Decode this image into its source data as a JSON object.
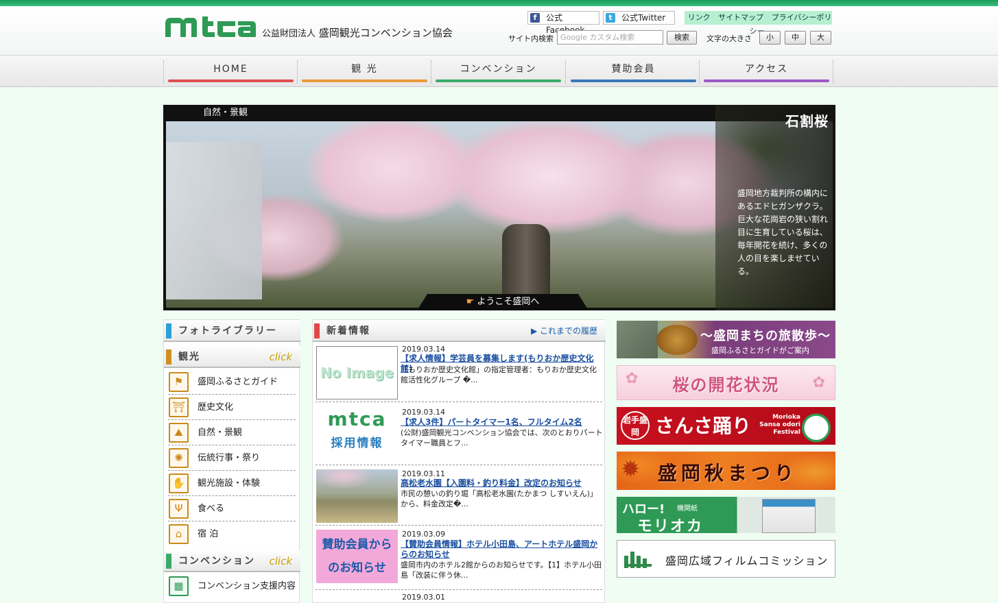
{
  "header": {
    "logo_text": "mtca",
    "org_prefix": "公益財団法人",
    "org_name": "盛岡観光コンベンション協会",
    "facebook_label": "公式Facebook",
    "twitter_label": "公式Twitter",
    "utility_links": [
      "リンク",
      "サイトマップ",
      "プライバシーポリシー"
    ],
    "search_label": "サイト内検索",
    "search_placeholder": "Google カスタム検索",
    "search_button": "検索",
    "text_size_label": "文字の大きさ",
    "text_sizes": [
      "小",
      "中",
      "大"
    ]
  },
  "nav": [
    {
      "label": "HOME",
      "color": "#e05050"
    },
    {
      "label": "観 光",
      "color": "#e89a3a"
    },
    {
      "label": "コンベンション",
      "color": "#3aaa6a"
    },
    {
      "label": "賛助会員",
      "color": "#3a78b8"
    },
    {
      "label": "アクセス",
      "color": "#9a5ac8"
    }
  ],
  "hero": {
    "category": "自然・景観",
    "title": "石割桜",
    "description": "盛岡地方裁判所の構内にあるエドヒガンザクラ。巨大な花崗岩の狭い割れ目に生育している桜は、毎年開花を続け、多くの人の目を楽しませている。",
    "welcome": "ようこそ盛岡へ"
  },
  "sidebar": {
    "photo_library": "フォトライブラリー",
    "tourism": {
      "title": "観光",
      "click": "click",
      "items": [
        {
          "label": "盛岡ふるさとガイド",
          "icon": "guide-icon"
        },
        {
          "label": "歴史文化",
          "icon": "castle-icon"
        },
        {
          "label": "自然・景観",
          "icon": "mountain-icon"
        },
        {
          "label": "伝統行事・祭り",
          "icon": "fan-icon"
        },
        {
          "label": "観光施設・体験",
          "icon": "person-icon"
        },
        {
          "label": "食べる",
          "icon": "chopsticks-icon"
        },
        {
          "label": "宿 泊",
          "icon": "hotel-icon"
        }
      ]
    },
    "convention": {
      "title": "コンベンション",
      "click": "click",
      "items": [
        {
          "label": "コンベンション支援内容",
          "icon": "convention-icon"
        }
      ]
    },
    "colors": {
      "photo": "#2aa0d8",
      "tourism": "#d09020",
      "convention": "#3aaa6a"
    }
  },
  "news": {
    "title": "新着情報",
    "more": "▶ これまでの履歴",
    "items": [
      {
        "date": "2019.03.14",
        "title": "【求人情報】学芸員を募集します(もりおか歴史文化館)",
        "body": "「もりおか歴史文化館」の指定管理者：もりおか歴史文化館活性化グループ �...",
        "thumb": "No Image"
      },
      {
        "date": "2019.03.14",
        "title": "【求人3件】パートタイマー1名、フルタイム2名",
        "body": "(公財)盛岡観光コンベンション協会では、次のとおりパートタイマー職員とフ...",
        "thumb": "採用情報"
      },
      {
        "date": "2019.03.11",
        "title": "高松老水園【入園料・釣り料金】改定のお知らせ",
        "body": "市民の憩いの釣り堀「高松老水園(たかまつ しすいえん)」から、料金改定�...",
        "thumb": ""
      },
      {
        "date": "2019.03.09",
        "title": "【賛助会員情報】ホテル小田島、アートホテル盛岡からのお知らせ",
        "body": "盛岡市内のホテル2館からのお知らせです。【1】ホテル小田島「改装に伴う休...",
        "thumb": "賛助会員からのお知らせ"
      },
      {
        "date": "2019.03.01",
        "title": "",
        "body": "",
        "thumb": ""
      }
    ]
  },
  "banners": {
    "b1_title": "〜盛岡まちの旅散歩〜",
    "b1_sub": "盛岡ふるさとガイドがご案内",
    "b2": "桜の開花状況",
    "b3_left": "岩手盛岡",
    "b3_main": "さんさ踊り",
    "b3_en": "Morioka Sansa odori Festival",
    "b4": "盛岡秋まつり",
    "b5_hello": "ハロー!",
    "b5_kikan": "機関紙",
    "b5_main": "モリオカ",
    "b6": "盛岡広域フィルムコミッション"
  }
}
